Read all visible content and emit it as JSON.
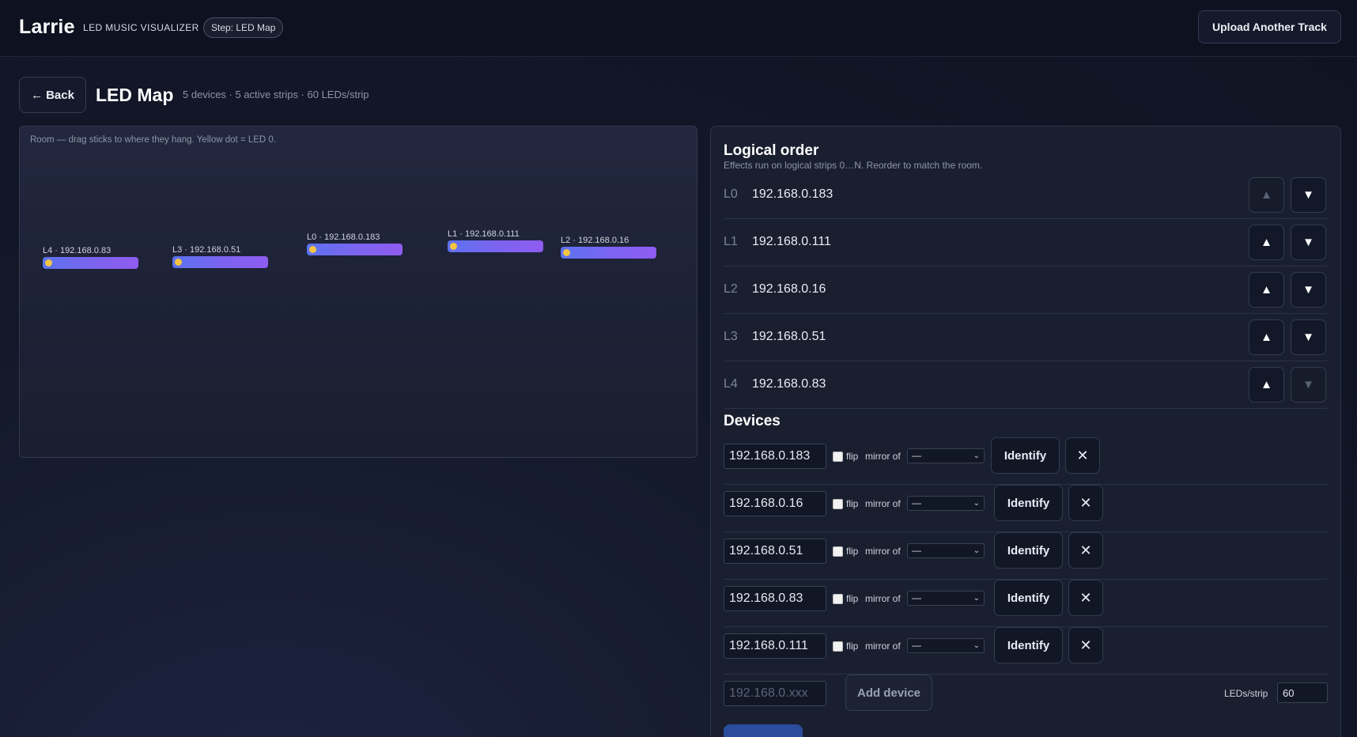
{
  "app": {
    "title": "Larrie",
    "subtitle": "LED MUSIC VISUALIZER",
    "step": "Step: LED Map",
    "upload_label": "Upload Another Track"
  },
  "page": {
    "back_label": "Back",
    "title": "LED Map",
    "meta": "5 devices · 5 active strips · 60 LEDs/strip"
  },
  "room": {
    "hint": "Room — drag sticks to where they hang. Yellow dot = LED 0.",
    "sticks": [
      {
        "label": "L4 · 192.168.0.83"
      },
      {
        "label": "L3 · 192.168.0.51"
      },
      {
        "label": "L0 · 192.168.0.183"
      },
      {
        "label": "L1 · 192.168.0.111"
      },
      {
        "label": "L2 · 192.168.0.16"
      }
    ]
  },
  "logical_order": {
    "title": "Logical order",
    "subtitle": "Effects run on logical strips 0…N. Reorder to match the room.",
    "rows": [
      {
        "index": "L0",
        "ip": "192.168.0.183",
        "up_disabled": true,
        "down_disabled": false
      },
      {
        "index": "L1",
        "ip": "192.168.0.111",
        "up_disabled": false,
        "down_disabled": false
      },
      {
        "index": "L2",
        "ip": "192.168.0.16",
        "up_disabled": false,
        "down_disabled": false
      },
      {
        "index": "L3",
        "ip": "192.168.0.51",
        "up_disabled": false,
        "down_disabled": false
      },
      {
        "index": "L4",
        "ip": "192.168.0.83",
        "up_disabled": false,
        "down_disabled": true
      }
    ],
    "up_glyph": "▲",
    "down_glyph": "▼"
  },
  "devices": {
    "title": "Devices",
    "flip_label": "flip",
    "mirror_label": "mirror of",
    "identify_label": "Identify",
    "remove_glyph": "✕",
    "items": [
      {
        "ip": "192.168.0.183",
        "flip": false,
        "mirror": "—"
      },
      {
        "ip": "192.168.0.16",
        "flip": false,
        "mirror": "—"
      },
      {
        "ip": "192.168.0.51",
        "flip": false,
        "mirror": "—"
      },
      {
        "ip": "192.168.0.83",
        "flip": false,
        "mirror": "—"
      },
      {
        "ip": "192.168.0.111",
        "flip": false,
        "mirror": "—"
      }
    ],
    "new_placeholder": "192.168.0.xxx",
    "add_label": "Add device",
    "leds_label": "LEDs/strip",
    "leds_value": "60"
  },
  "colors": {
    "led0_dot": "#f4c542",
    "strip_start": "#5c73f0",
    "strip_end": "#8f5cf0",
    "save_button": "#2b4b9c"
  }
}
